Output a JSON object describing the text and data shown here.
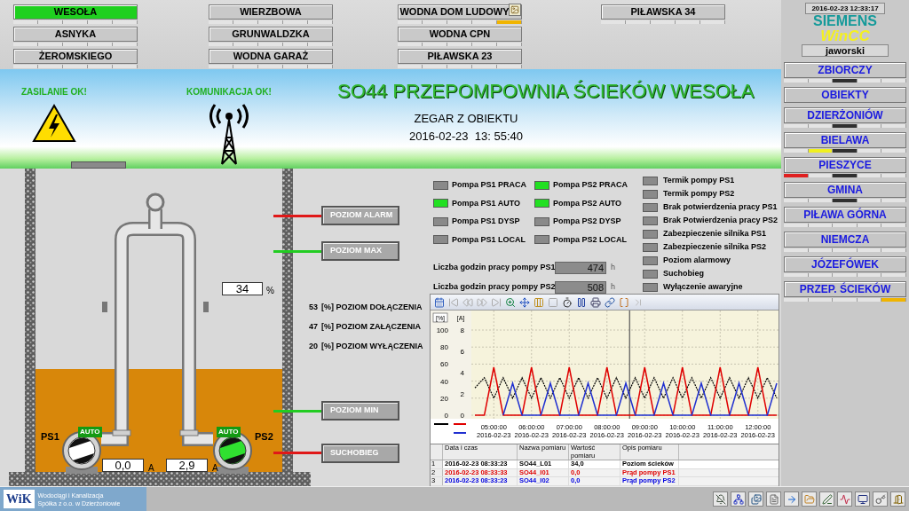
{
  "top_nav": [
    [
      {
        "label": "WESOŁA",
        "selected": true,
        "flagged": false,
        "alarms": [
          {
            "color": "#e4e4e4"
          },
          {
            "color": "#e4e4e4"
          },
          {
            "color": "#e4e4e4"
          },
          {
            "color": "#e4e4e4"
          },
          {
            "color": "#e4e4e4"
          }
        ]
      },
      {
        "label": "ASNYKA",
        "selected": false,
        "flagged": false,
        "alarms": [
          {
            "color": "#e4e4e4"
          },
          {
            "color": "#e4e4e4"
          },
          {
            "color": "#e4e4e4"
          },
          {
            "color": "#e4e4e4"
          },
          {
            "color": "#e4e4e4"
          }
        ]
      },
      {
        "label": "ŻEROMSKIEGO",
        "selected": false,
        "flagged": false,
        "alarms": [
          {
            "color": "#e4e4e4"
          },
          {
            "color": "#e4e4e4"
          },
          {
            "color": "#e4e4e4"
          },
          {
            "color": "#e4e4e4"
          },
          {
            "color": "#e4e4e4"
          }
        ]
      }
    ],
    [
      {
        "label": "WIERZBOWA",
        "selected": false,
        "flagged": false,
        "alarms": [
          {
            "color": "#e4e4e4"
          },
          {
            "color": "#e4e4e4"
          },
          {
            "color": "#e4e4e4"
          },
          {
            "color": "#e4e4e4"
          },
          {
            "color": "#e4e4e4"
          }
        ]
      },
      {
        "label": "GRUNWALDZKA",
        "selected": false,
        "flagged": false,
        "alarms": [
          {
            "color": "#e4e4e4"
          },
          {
            "color": "#e4e4e4"
          },
          {
            "color": "#e4e4e4"
          },
          {
            "color": "#e4e4e4"
          },
          {
            "color": "#e4e4e4"
          }
        ]
      },
      {
        "label": "WODNA GARAŻ",
        "selected": false,
        "flagged": false,
        "alarms": [
          {
            "color": "#e4e4e4"
          },
          {
            "color": "#e4e4e4"
          },
          {
            "color": "#e4e4e4"
          },
          {
            "color": "#e4e4e4"
          },
          {
            "color": "#e4e4e4"
          }
        ]
      }
    ],
    [
      {
        "label": "WODNA DOM LUDOWY",
        "selected": false,
        "flagged": true,
        "alarms": [
          {
            "color": "#e4e4e4"
          },
          {
            "color": "#e4e4e4"
          },
          {
            "color": "#e4e4e4"
          },
          {
            "color": "#e4e4e4"
          },
          {
            "color": "#f0b400"
          }
        ]
      },
      {
        "label": "WODNA CPN",
        "selected": false,
        "flagged": false,
        "alarms": [
          {
            "color": "#e4e4e4"
          },
          {
            "color": "#e4e4e4"
          },
          {
            "color": "#e4e4e4"
          },
          {
            "color": "#e4e4e4"
          },
          {
            "color": "#e4e4e4"
          }
        ]
      },
      {
        "label": "PIŁAWSKA 23",
        "selected": false,
        "flagged": false,
        "alarms": [
          {
            "color": "#e4e4e4"
          },
          {
            "color": "#e4e4e4"
          },
          {
            "color": "#e4e4e4"
          },
          {
            "color": "#e4e4e4"
          },
          {
            "color": "#e4e4e4"
          }
        ]
      }
    ],
    [
      {
        "label": "PIŁAWSKA 34",
        "selected": false,
        "flagged": false,
        "alarms": [
          {
            "color": "#e4e4e4"
          },
          {
            "color": "#e4e4e4"
          },
          {
            "color": "#e4e4e4"
          },
          {
            "color": "#e4e4e4"
          },
          {
            "color": "#e4e4e4"
          }
        ]
      }
    ]
  ],
  "banner": {
    "power_status": "ZASILANIE OK!",
    "comm_status": "KOMUNIKACJA OK!",
    "title": "SO44 PRZEPOMPOWNIA ŚCIEKÓW WESOŁA",
    "clock_label": "ZEGAR Z OBIEKTU",
    "clock": "2016-02-23  13: 55:40"
  },
  "tank": {
    "level": 0.34,
    "level_reading": "34",
    "level_unit": "%",
    "pumps": [
      {
        "name": "PS1",
        "mode": "AUTO",
        "running": false,
        "current": "0,0",
        "unit": "A"
      },
      {
        "name": "PS2",
        "mode": "AUTO",
        "running": true,
        "current": "2,9",
        "unit": "A"
      }
    ],
    "level_switches": [
      {
        "label": "POZIOM ALARM",
        "color": "#e01818"
      },
      {
        "label": "POZIOM MAX",
        "color": "#22cc22"
      },
      {
        "label": "POZIOM MIN",
        "color": "#22cc22"
      },
      {
        "label": "SUCHOBIEG",
        "color": "#e01818"
      }
    ],
    "setpoints": [
      {
        "value": "53",
        "label": "[%] POZIOM DOŁĄCZENIA"
      },
      {
        "value": "47",
        "label": "[%] POZIOM ZAŁĄCZENIA"
      },
      {
        "value": "20",
        "label": "[%] POZIOM WYŁĄCZENIA"
      }
    ]
  },
  "pump_signals": [
    {
      "label": "Pompa PS1 PRACA",
      "on": false
    },
    {
      "label": "Pompa PS2 PRACA",
      "on": true
    },
    {
      "label": "Pompa PS1 AUTO",
      "on": true
    },
    {
      "label": "Pompa PS2 AUTO",
      "on": true
    },
    {
      "label": "Pompa PS1 DYSP",
      "on": false
    },
    {
      "label": "Pompa PS2 DYSP",
      "on": false
    },
    {
      "label": "Pompa PS1 LOCAL",
      "on": false
    },
    {
      "label": "Pompa PS2 LOCAL",
      "on": false
    }
  ],
  "run_hours": [
    {
      "label": "Liczba godzin pracy pompy PS1",
      "value": "474",
      "unit": "h"
    },
    {
      "label": "Liczba godzin pracy pompy PS2",
      "value": "508",
      "unit": "h"
    }
  ],
  "alarms": [
    {
      "label": "Termik pompy PS1",
      "on": false
    },
    {
      "label": "Termik pompy PS2",
      "on": false
    },
    {
      "label": "Brak potwierdzenia pracy PS1",
      "on": false
    },
    {
      "label": "Brak Potwierdzenia pracy PS2",
      "on": false
    },
    {
      "label": "Zabezpieczenie silnika PS1",
      "on": false
    },
    {
      "label": "Zabezpieczenie silnika PS2",
      "on": false
    },
    {
      "label": "Poziom alarmowy",
      "on": false
    },
    {
      "label": "Suchobieg",
      "on": false
    },
    {
      "label": "Wyłączenie awaryjne",
      "on": false
    }
  ],
  "trend": {
    "chart_data": {
      "type": "line",
      "grid": true,
      "ylabel": "[%]",
      "y2label": "[A]",
      "ylim": [
        0,
        100
      ],
      "y2lim": [
        0,
        8
      ],
      "yticks": [
        0,
        20,
        40,
        60,
        80,
        100
      ],
      "y2ticks": [
        0,
        2,
        4,
        6,
        8
      ],
      "categories": [
        null,
        null,
        "05:00:00 2016-02-23",
        null,
        null,
        null,
        "06:00:00 2016-02-23",
        null,
        null,
        null,
        "07:00:00 2016-02-23",
        null,
        null,
        null,
        "08:00:00 2016-02-23",
        null,
        null,
        null,
        "09:00:00 2016-02-23",
        null,
        null,
        null,
        "10:00:00 2016-02-23",
        null,
        null,
        null,
        "11:00:00 2016-02-23",
        null,
        null,
        null,
        "12:00:00 2016-02-23",
        null,
        null
      ],
      "series": [
        {
          "color": "#000000",
          "line_style": "dashed",
          "values": [
            32,
            44,
            20,
            44,
            20,
            44,
            20,
            44,
            20,
            44,
            20,
            44,
            20,
            44,
            20,
            44,
            20,
            44,
            20,
            44,
            20,
            44,
            20,
            44,
            20,
            44,
            20,
            44,
            20,
            44,
            20,
            44,
            20
          ]
        },
        {
          "color": "#e00000",
          "axis": "y2",
          "line_style": "solid",
          "values": [
            0,
            0,
            4.5,
            0,
            0,
            0,
            4.5,
            0,
            0,
            0,
            4.5,
            0,
            0,
            0,
            4.5,
            0,
            0,
            0,
            4.5,
            0,
            0,
            0,
            4.5,
            0,
            0,
            0,
            4.5,
            0,
            0,
            0,
            4.5,
            0,
            0
          ]
        },
        {
          "color": "#2030d0",
          "axis": "y2",
          "line_style": "solid",
          "values": [
            null,
            null,
            null,
            0,
            3,
            0,
            0,
            0,
            3,
            0,
            0,
            0,
            3,
            0,
            0,
            0,
            3,
            0,
            0,
            0,
            3,
            0,
            0,
            0,
            3,
            0,
            0,
            0,
            3,
            0,
            0,
            0,
            3
          ]
        }
      ]
    },
    "table": {
      "columns": [
        "Data i czas",
        "Nazwa pomiaru",
        "Wartość pomiaru",
        "Opis pomiaru"
      ],
      "rows": [
        {
          "index": "1",
          "color": "#000000",
          "cells": [
            "2016-02-23 08:33:23",
            "SO44_L01",
            "34,0",
            "Poziom ścieków"
          ]
        },
        {
          "index": "2",
          "color": "#e00000",
          "cells": [
            "2016-02-23 08:33:33",
            "SO44_I01",
            "0,0",
            "Prąd pompy PS1"
          ]
        },
        {
          "index": "3",
          "color": "#0000e0",
          "cells": [
            "2016-02-23 08:33:23",
            "SO44_I02",
            "0,0",
            "Prąd pompy PS2"
          ]
        }
      ]
    }
  },
  "sidebar": {
    "datetime": "2016-02-23 12:33:17",
    "brand": "SIEMENS",
    "product": "WinCC",
    "user": "jaworski",
    "items": [
      {
        "label": "ZBIORCZY",
        "selected": false,
        "alarms": [
          {
            "color": "#e4e4e4"
          },
          {
            "color": "#e4e4e4"
          },
          {
            "color": "#303030"
          },
          {
            "color": "#e4e4e4"
          },
          {
            "color": "#e4e4e4"
          }
        ]
      },
      {
        "label": "OBIEKTY",
        "selected": false
      },
      {
        "label": "DZIERŻONIÓW",
        "selected": false,
        "alarms": [
          {
            "color": "#e4e4e4"
          },
          {
            "color": "#e4e4e4"
          },
          {
            "color": "#303030"
          },
          {
            "color": "#e4e4e4"
          },
          {
            "color": "#e4e4e4"
          }
        ]
      },
      {
        "label": "BIELAWA",
        "selected": false,
        "alarms": [
          {
            "color": "#e4e4e4"
          },
          {
            "color": "#f0f020"
          },
          {
            "color": "#303030"
          },
          {
            "color": "#e4e4e4"
          },
          {
            "color": "#e4e4e4"
          }
        ]
      },
      {
        "label": "PIESZYCE",
        "selected": false,
        "alarms": [
          {
            "color": "#e02020"
          },
          {
            "color": "#e4e4e4"
          },
          {
            "color": "#303030"
          },
          {
            "color": "#e4e4e4"
          },
          {
            "color": "#e4e4e4"
          }
        ]
      },
      {
        "label": "GMINA",
        "selected": false,
        "alarms": [
          {
            "color": "#e4e4e4"
          },
          {
            "color": "#e4e4e4"
          },
          {
            "color": "#303030"
          },
          {
            "color": "#e4e4e4"
          },
          {
            "color": "#e4e4e4"
          }
        ]
      },
      {
        "label": "PIŁAWA GÓRNA",
        "selected": false,
        "alarms": [
          {
            "color": "#e4e4e4"
          },
          {
            "color": "#e4e4e4"
          },
          {
            "color": "#e4e4e4"
          },
          {
            "color": "#e4e4e4"
          },
          {
            "color": "#e4e4e4"
          }
        ]
      },
      {
        "label": "NIEMCZA",
        "selected": false,
        "alarms": [
          {
            "color": "#e4e4e4"
          },
          {
            "color": "#e4e4e4"
          },
          {
            "color": "#e4e4e4"
          },
          {
            "color": "#e4e4e4"
          },
          {
            "color": "#e4e4e4"
          }
        ]
      },
      {
        "label": "JÓZEFÓWEK",
        "selected": false,
        "alarms": [
          {
            "color": "#e4e4e4"
          },
          {
            "color": "#e4e4e4"
          },
          {
            "color": "#e4e4e4"
          },
          {
            "color": "#e4e4e4"
          },
          {
            "color": "#e4e4e4"
          }
        ]
      },
      {
        "label": "PRZEP. ŚCIEKÓW",
        "selected": false,
        "alarms": [
          {
            "color": "#e4e4e4"
          },
          {
            "color": "#e4e4e4"
          },
          {
            "color": "#e4e4e4"
          },
          {
            "color": "#e4e4e4"
          },
          {
            "color": "#f0b400"
          }
        ]
      }
    ]
  },
  "footer": {
    "logo": "WiK",
    "company_line1": "Wodociągi i Kanalizacja",
    "company_line2": "Spółka z o.o. w Dzierżoniowie"
  }
}
